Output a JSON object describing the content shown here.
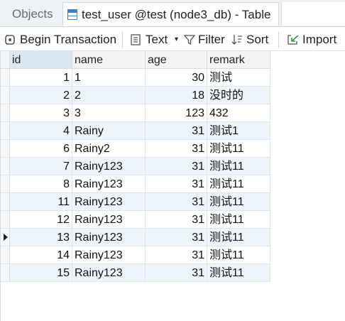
{
  "tabs": {
    "objects": "Objects",
    "table": "test_user @test (node3_db) - Table"
  },
  "toolbar": {
    "begin_transaction": "Begin Transaction",
    "text": "Text",
    "filter": "Filter",
    "sort": "Sort",
    "import": "Import"
  },
  "columns": [
    "id",
    "name",
    "age",
    "remark"
  ],
  "rows": [
    {
      "id": "1",
      "name": "1",
      "age": "30",
      "remark": "测试"
    },
    {
      "id": "2",
      "name": "2",
      "age": "18",
      "remark": "没时的"
    },
    {
      "id": "3",
      "name": "3",
      "age": "123",
      "remark": "432"
    },
    {
      "id": "4",
      "name": "Rainy",
      "age": "31",
      "remark": "测试1"
    },
    {
      "id": "6",
      "name": "Rainy2",
      "age": "31",
      "remark": "测试11"
    },
    {
      "id": "7",
      "name": "Rainy123",
      "age": "31",
      "remark": "测试11"
    },
    {
      "id": "8",
      "name": "Rainy123",
      "age": "31",
      "remark": "测试11"
    },
    {
      "id": "11",
      "name": "Rainy123",
      "age": "31",
      "remark": "测试11"
    },
    {
      "id": "12",
      "name": "Rainy123",
      "age": "31",
      "remark": "测试11"
    },
    {
      "id": "13",
      "name": "Rainy123",
      "age": "31",
      "remark": "测试11"
    },
    {
      "id": "14",
      "name": "Rainy123",
      "age": "31",
      "remark": "测试11"
    },
    {
      "id": "15",
      "name": "Rainy123",
      "age": "31",
      "remark": "测试11"
    }
  ],
  "selected_row_id": "13",
  "colors": {
    "header_bg": "#f3f4f6",
    "selected_header_bg": "#dce7f6",
    "alt_row_bg": "#eef4fc",
    "accent": "#3c7fd6"
  }
}
